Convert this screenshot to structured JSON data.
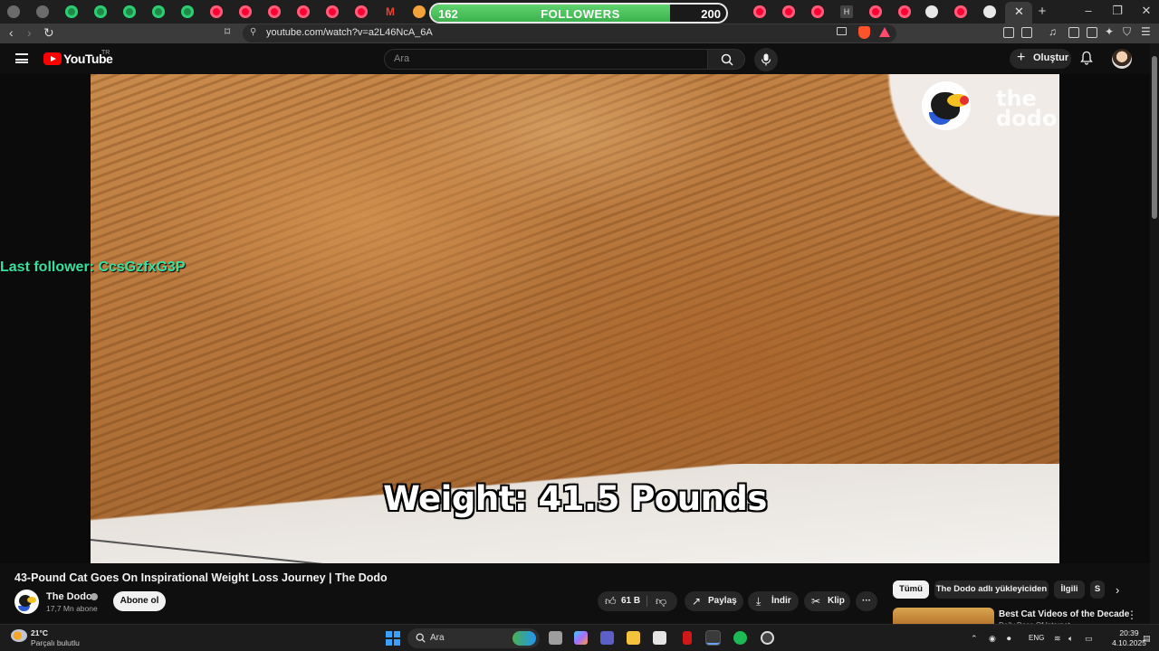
{
  "stream_overlay": {
    "followers_current": "162",
    "followers_label": "FOLLOWERS",
    "followers_goal": "200",
    "followers_progress": 0.81,
    "last_follower_text": "Last follower: CcsGzfxG3P"
  },
  "browser": {
    "url": "youtube.com/watch?v=a2L46NcA_6A",
    "active_tab_close": "✕",
    "new_tab": "+"
  },
  "youtube": {
    "brand": "YouTube",
    "country_code": "TR",
    "search_placeholder": "Ara",
    "create_label": "Oluştur"
  },
  "video": {
    "caption": "Weight: 41.5 Pounds",
    "watermark": "the\ndodo",
    "title": "43-Pound Cat Goes On Inspirational Weight Loss Journey | The Dodo"
  },
  "channel": {
    "name": "The Dodo",
    "subscribers": "17,7 Mn abone",
    "subscribe_label": "Abone ol"
  },
  "actions": {
    "likes": "61 B",
    "share": "Paylaş",
    "download": "İndir",
    "clip": "Klip",
    "more": "···"
  },
  "chips": [
    {
      "label": "Tümü"
    },
    {
      "label": "The Dodo adlı yükleyiciden"
    },
    {
      "label": "İlgili"
    },
    {
      "label": "S"
    }
  ],
  "recommendation": {
    "title": "Best Cat Videos of the Decade",
    "channel": "Daily Dose Of Internet"
  },
  "taskbar": {
    "temperature": "21°C",
    "weather": "Parçalı bulutlu",
    "search_label": "Ara",
    "language": "ENG",
    "time": "20:39",
    "date": "4.10.2025"
  },
  "colors": {
    "yt_red": "#ff0000",
    "follower_green": "#3cb24e",
    "last_follower": "#35e2a2"
  }
}
